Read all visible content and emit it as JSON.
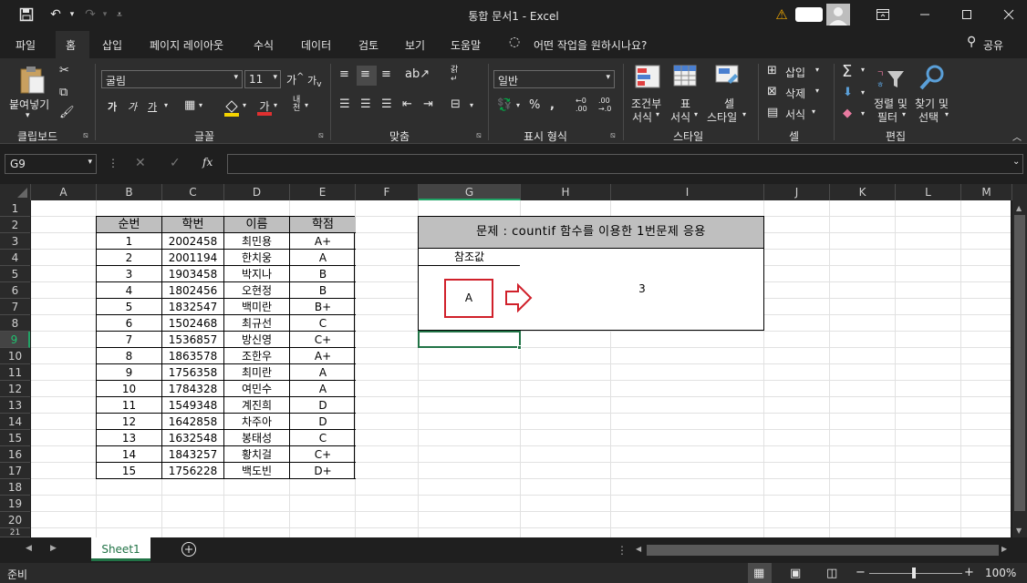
{
  "titlebar": {
    "title": "통합 문서1  -  Excel"
  },
  "menu": [
    "파일",
    "홈",
    "삽입",
    "페이지 레이아웃",
    "수식",
    "데이터",
    "검토",
    "보기",
    "도움말"
  ],
  "tell_me": "어떤 작업을 원하시나요?",
  "share": "공유",
  "ribbon": {
    "paste": "붙여넣기",
    "font_name": "굴림",
    "font_size": "11",
    "number_format": "일반",
    "cond_format": [
      "조건부",
      "서식"
    ],
    "table_format": [
      "표",
      "서식"
    ],
    "cell_style": [
      "셀",
      "스타일"
    ],
    "insert": "삽입",
    "delete": "삭제",
    "format": "서식",
    "sort_filter": [
      "정렬 및",
      "필터"
    ],
    "find_select": [
      "찾기 및",
      "선택"
    ],
    "groups": [
      "클립보드",
      "글꼴",
      "맞춤",
      "표시 형식",
      "스타일",
      "셀",
      "편집"
    ]
  },
  "namebox": "G9",
  "columns": [
    "A",
    "B",
    "C",
    "D",
    "E",
    "F",
    "G",
    "H",
    "I",
    "J",
    "K",
    "L",
    "M"
  ],
  "rows": [
    "1",
    "2",
    "3",
    "4",
    "5",
    "6",
    "7",
    "8",
    "9",
    "10",
    "11",
    "12",
    "13",
    "14",
    "15",
    "16",
    "17",
    "18",
    "19",
    "20",
    "21"
  ],
  "table": {
    "headers": [
      "순번",
      "학번",
      "이름",
      "학점"
    ],
    "rows": [
      [
        "1",
        "2002458",
        "최민용",
        "A+"
      ],
      [
        "2",
        "2001194",
        "한치웅",
        "A"
      ],
      [
        "3",
        "1903458",
        "박지나",
        "B"
      ],
      [
        "4",
        "1802456",
        "오현정",
        "B"
      ],
      [
        "5",
        "1832547",
        "백미란",
        "B+"
      ],
      [
        "6",
        "1502468",
        "최규선",
        "C"
      ],
      [
        "7",
        "1536857",
        "방신영",
        "C+"
      ],
      [
        "8",
        "1863578",
        "조한우",
        "A+"
      ],
      [
        "9",
        "1756358",
        "최미란",
        "A"
      ],
      [
        "10",
        "1784328",
        "여민수",
        "A"
      ],
      [
        "11",
        "1549348",
        "계진희",
        "D"
      ],
      [
        "12",
        "1642858",
        "차주아",
        "D"
      ],
      [
        "13",
        "1632548",
        "봉태성",
        "C"
      ],
      [
        "14",
        "1843257",
        "황치걸",
        "C+"
      ],
      [
        "15",
        "1756228",
        "백도빈",
        "D+"
      ]
    ]
  },
  "problem": {
    "title": "문제 : countif 함수를 이용한 1번문제 응용",
    "ref_label": "참조값",
    "ref_value": "A",
    "result": "3"
  },
  "sheet_tab": "Sheet1",
  "status": {
    "ready": "준비",
    "zoom": "100%"
  }
}
